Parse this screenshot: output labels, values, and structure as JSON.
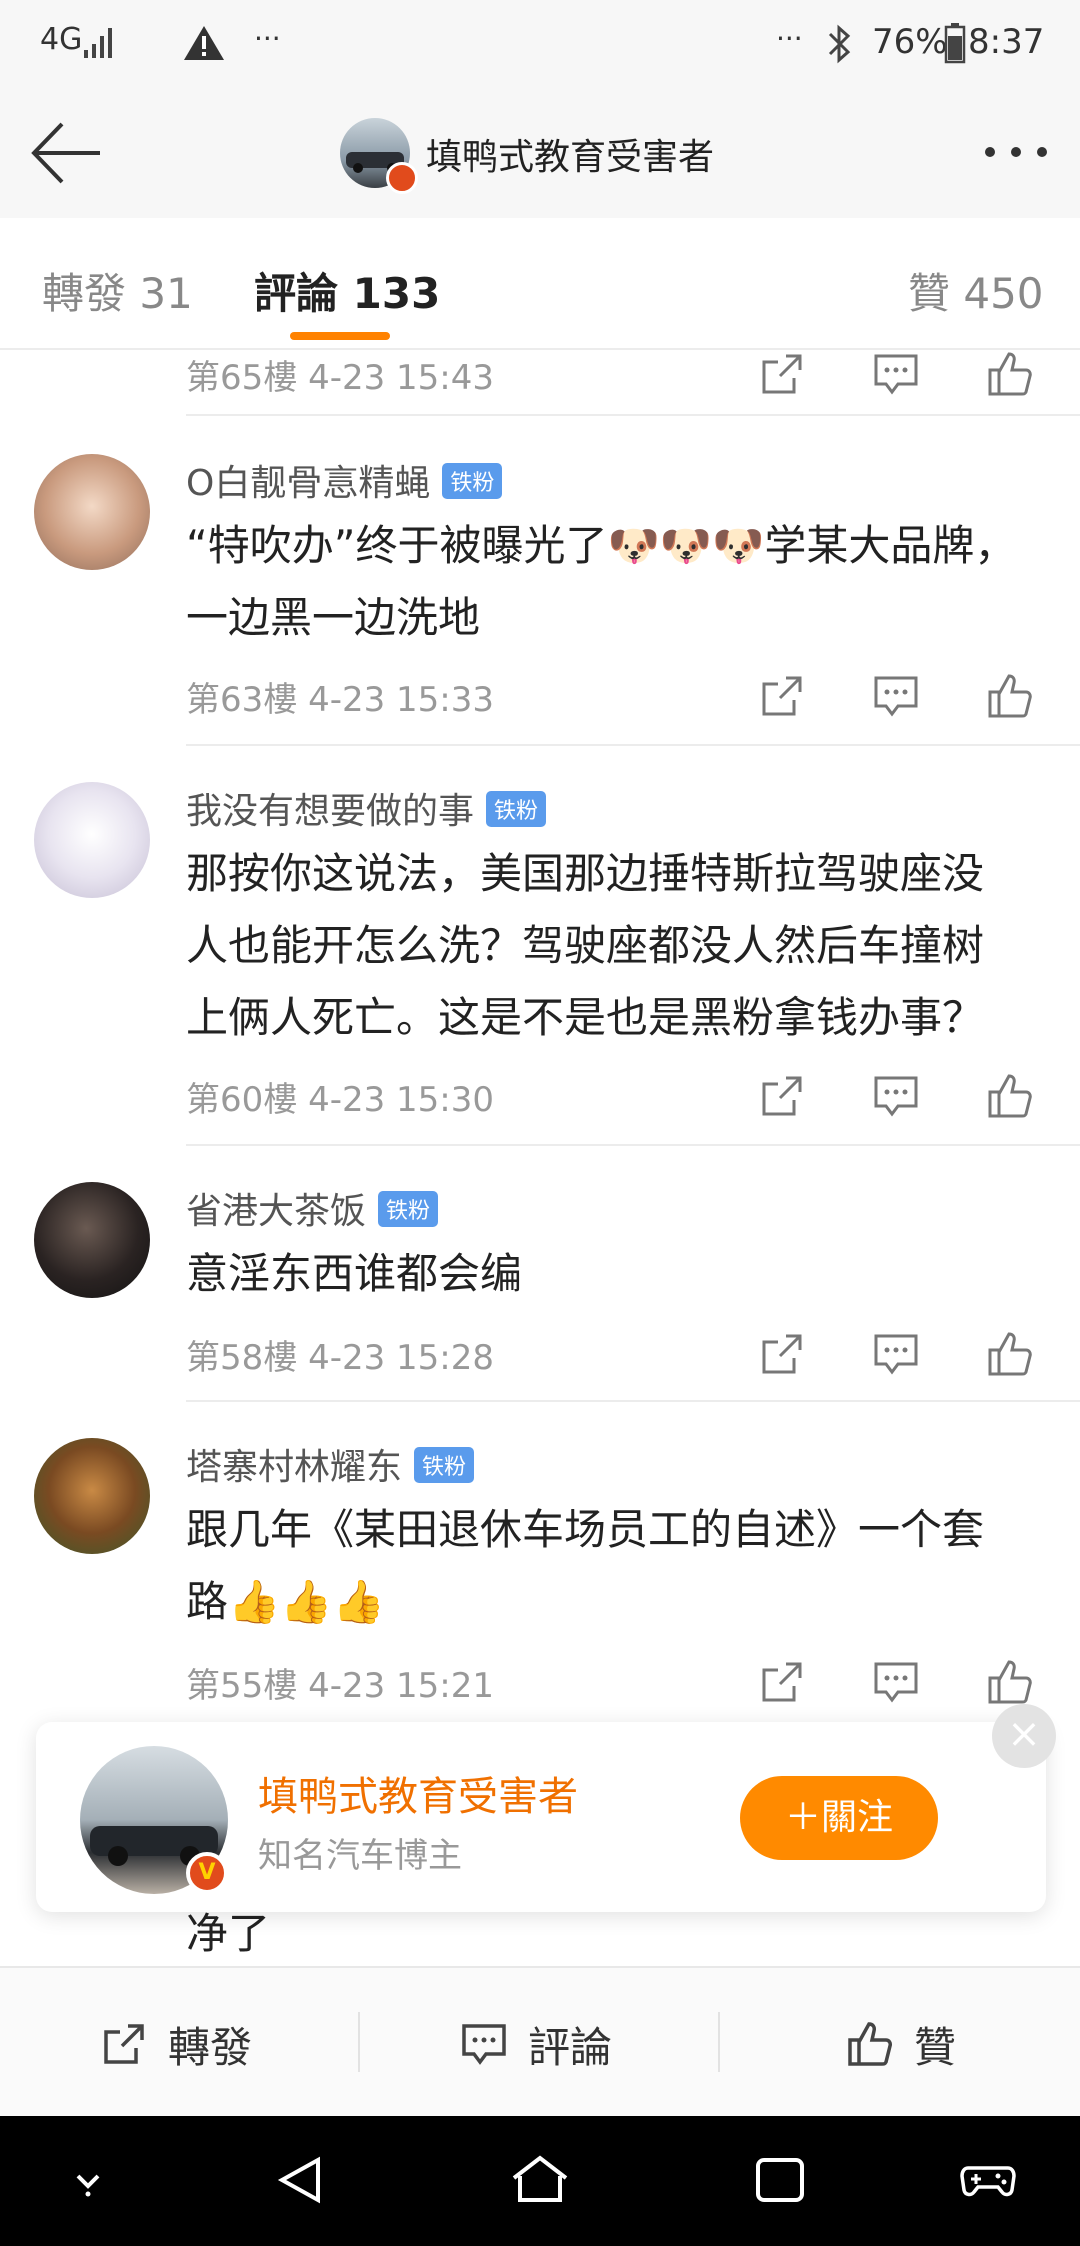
{
  "status_bar": {
    "network": "4G",
    "dots_left": "···",
    "dots_right": "···",
    "battery": "76%",
    "time": "8:37"
  },
  "header": {
    "title": "填鸭式教育受害者"
  },
  "tabs": [
    {
      "label": "轉發 31"
    },
    {
      "label": "評論 133"
    },
    {
      "label": "贊 450"
    }
  ],
  "partial_meta": "第65樓  4-23 15:43",
  "comments": [
    {
      "user": "O白靓骨悥精蝇",
      "badge": "铁粉",
      "lines": [
        "“特吹办”终于被曝光了🐶🐶🐶学某大品牌，",
        "一边黑一边洗地"
      ],
      "meta": "第63樓  4-23 15:33"
    },
    {
      "user": "我没有想要做的事",
      "badge": "铁粉",
      "lines": [
        "那按你这说法，美国那边捶特斯拉驾驶座没",
        "人也能开怎么洗？驾驶座都没人然后车撞树",
        "上俩人死亡。这是不是也是黑粉拿钱办事？"
      ],
      "meta": "第60樓  4-23 15:30"
    },
    {
      "user": "省港大茶饭",
      "badge": "铁粉",
      "lines": [
        "意淫东西谁都会编"
      ],
      "meta": "第58樓  4-23 15:28"
    },
    {
      "user": "塔寨村林耀东",
      "badge": "铁粉",
      "lines": [
        "跟几年《某田退休车场员工的自述》一个套",
        "路👍👍👍"
      ],
      "meta": "第55樓  4-23 15:21"
    }
  ],
  "hidden_comment_tail": "净了",
  "follow_card": {
    "name": "填鸭式教育受害者",
    "subtitle": "知名汽车博主",
    "button": "＋關注",
    "close": "×",
    "badge": "V"
  },
  "action_bar": {
    "repost": "轉發",
    "comment": "評論",
    "like": "贊"
  },
  "colors": {
    "accent": "#ff8200",
    "name_orange": "#f07000",
    "fan_badge": "#5a9bec"
  }
}
